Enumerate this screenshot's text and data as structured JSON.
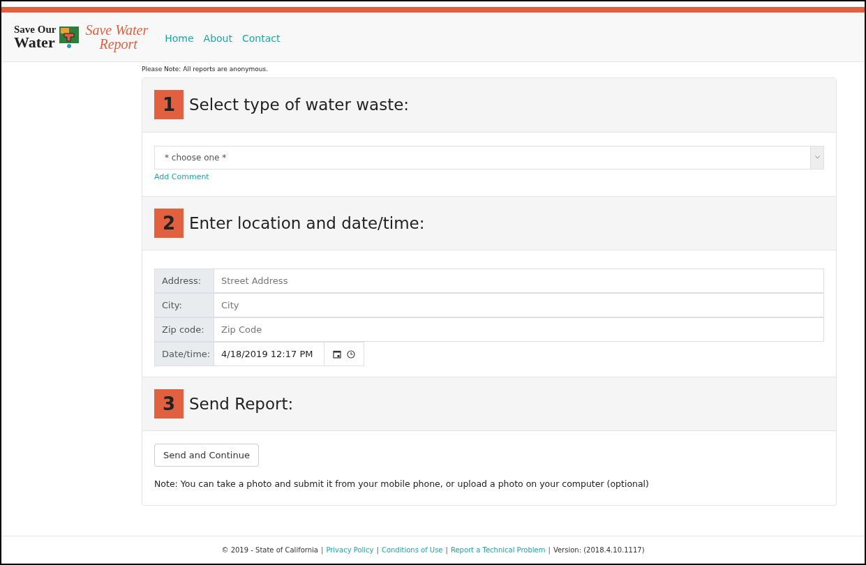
{
  "logo": {
    "line_1": "Save Our",
    "line_2": "Water",
    "script_1": "Save Water",
    "script_2": "Report"
  },
  "nav": [
    {
      "label": "Home"
    },
    {
      "label": "About"
    },
    {
      "label": "Contact"
    }
  ],
  "note": "Please Note: All reports are anonymous.",
  "steps": [
    {
      "number": "1",
      "title": "Select type of water waste:"
    },
    {
      "number": "2",
      "title": "Enter location and date/time:"
    },
    {
      "number": "3",
      "title": "Send Report:"
    }
  ],
  "waste_select": {
    "value": "* choose one *"
  },
  "add_comment": "Add Comment",
  "location_fields": [
    {
      "label": "Address:",
      "placeholder": "Street Address"
    },
    {
      "label": "City:",
      "placeholder": "City"
    },
    {
      "label": "Zip code:",
      "placeholder": "Zip Code"
    }
  ],
  "datetime": {
    "label": "Date/time:",
    "value": "4/18/2019 12:17 PM"
  },
  "send_button": "Send and Continue",
  "send_note": "Note: You can take a photo and submit it from your mobile phone, or upload a photo on your computer (optional)",
  "footer": [
    {
      "kind": "text",
      "text": "© 2019 - State of California"
    },
    {
      "kind": "separator",
      "text": "|"
    },
    {
      "kind": "link",
      "text": "Privacy Policy"
    },
    {
      "kind": "separator",
      "text": "|"
    },
    {
      "kind": "link",
      "text": "Conditions of Use"
    },
    {
      "kind": "separator",
      "text": "|"
    },
    {
      "kind": "link",
      "text": "Report a Technical Problem"
    },
    {
      "kind": "separator",
      "text": "|"
    },
    {
      "kind": "text",
      "text": "Version: (2018.4.10.1117)"
    }
  ]
}
